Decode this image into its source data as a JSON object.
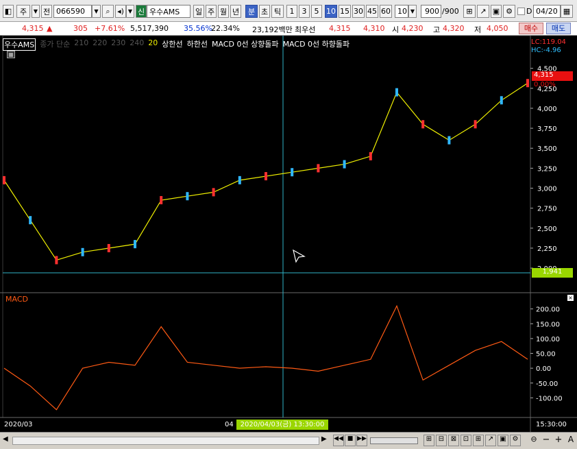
{
  "toolbar": {
    "type_label": "주",
    "prefix_label": "전",
    "code": "066590",
    "tag": "신",
    "stock_name": "우수AMS",
    "periods": [
      "일",
      "주",
      "월",
      "년",
      "분",
      "초",
      "틱"
    ],
    "active_period": "분",
    "intervals": [
      "1",
      "3",
      "5",
      "10",
      "15",
      "30",
      "45",
      "60"
    ],
    "active_interval": "10",
    "interval_select": "10",
    "count_value": "900",
    "count_total": "/900",
    "d_label": "D",
    "date_value": "04/20"
  },
  "info": {
    "price": "4,315",
    "arrow": "▲",
    "change": "305",
    "change_pct": "+7.61%",
    "volume": "5,517,390",
    "turnover": "35.56%",
    "ratio": "22.34%",
    "amount": "23,192백만",
    "pref_label": "최우선",
    "ask": "4,315",
    "bid": "4,310",
    "open_label": "시",
    "open": "4,230",
    "high_label": "고",
    "high": "4,320",
    "low_label": "저",
    "low": "4,050",
    "buy_label": "매수",
    "sell_label": "매도"
  },
  "legend": {
    "name": "우수AMS",
    "ma_label": "종가 단순",
    "ma_periods": [
      "210",
      "220",
      "230",
      "240"
    ],
    "ma20": "20",
    "upper": "상한선",
    "lower": "하한선",
    "macd_up": "MACD 0선 상향돌파",
    "macd_down": "MACD 0선 하향돌파"
  },
  "price_panel": {
    "lc": "LC:119.04",
    "hc": "HC:-4.96",
    "last_price": "4,315",
    "last_pct": "0.00%",
    "crosshair_price": "1,941",
    "colors": {
      "background": "#000000",
      "axis_text": "#ffffff",
      "last_price_bg": "#e81010",
      "crosshair_bg": "#9ad600",
      "crosshair": "#2fb3c8",
      "lc": "#ff3030",
      "hc": "#30c0ff",
      "ma20": "#f0f000",
      "bands": "#ffffff",
      "candle_up": "#ff3030",
      "candle_down": "#30b8ff"
    }
  },
  "macd_panel": {
    "title": "MACD",
    "line_color": "#ff5a14"
  },
  "xaxis": {
    "start": "2020/03",
    "mid": "04",
    "crosshair_time": "2020/04/03(금) 13:30:00",
    "end": "15:30:00"
  },
  "chart_data": [
    {
      "type": "line",
      "title": "우수AMS",
      "ylim": [
        1941,
        4600
      ],
      "yticks": [
        "4,500",
        "4,250",
        "4,000",
        "3,750",
        "3,500",
        "3,250",
        "3,000",
        "2,750",
        "2,500",
        "2,250",
        "2,000"
      ],
      "x": [
        0,
        5,
        10,
        15,
        20,
        25,
        30,
        35,
        40,
        45,
        50,
        55,
        60,
        65,
        70,
        75,
        80,
        85,
        90,
        95,
        100
      ],
      "series": [
        {
          "values": [
            3100,
            2600,
            2100,
            2200,
            2250,
            2300,
            2850,
            2900,
            2950,
            3100,
            3150,
            3200,
            3250,
            3300,
            3400,
            4200,
            3800,
            3600,
            3800,
            4100,
            4315
          ]
        }
      ]
    },
    {
      "type": "line",
      "title": "MACD",
      "ylim": [
        -150,
        220
      ],
      "yticks": [
        "200.00",
        "150.00",
        "100.00",
        "50.00",
        "0.00",
        "-50.00",
        "-100.00"
      ],
      "x": [
        0,
        5,
        10,
        15,
        20,
        25,
        30,
        35,
        40,
        45,
        50,
        55,
        60,
        65,
        70,
        75,
        80,
        85,
        90,
        95,
        100
      ],
      "series": [
        {
          "values": [
            0,
            -60,
            -140,
            0,
            20,
            10,
            140,
            20,
            10,
            0,
            5,
            0,
            -10,
            10,
            30,
            210,
            -40,
            10,
            60,
            90,
            30
          ]
        }
      ]
    }
  ]
}
